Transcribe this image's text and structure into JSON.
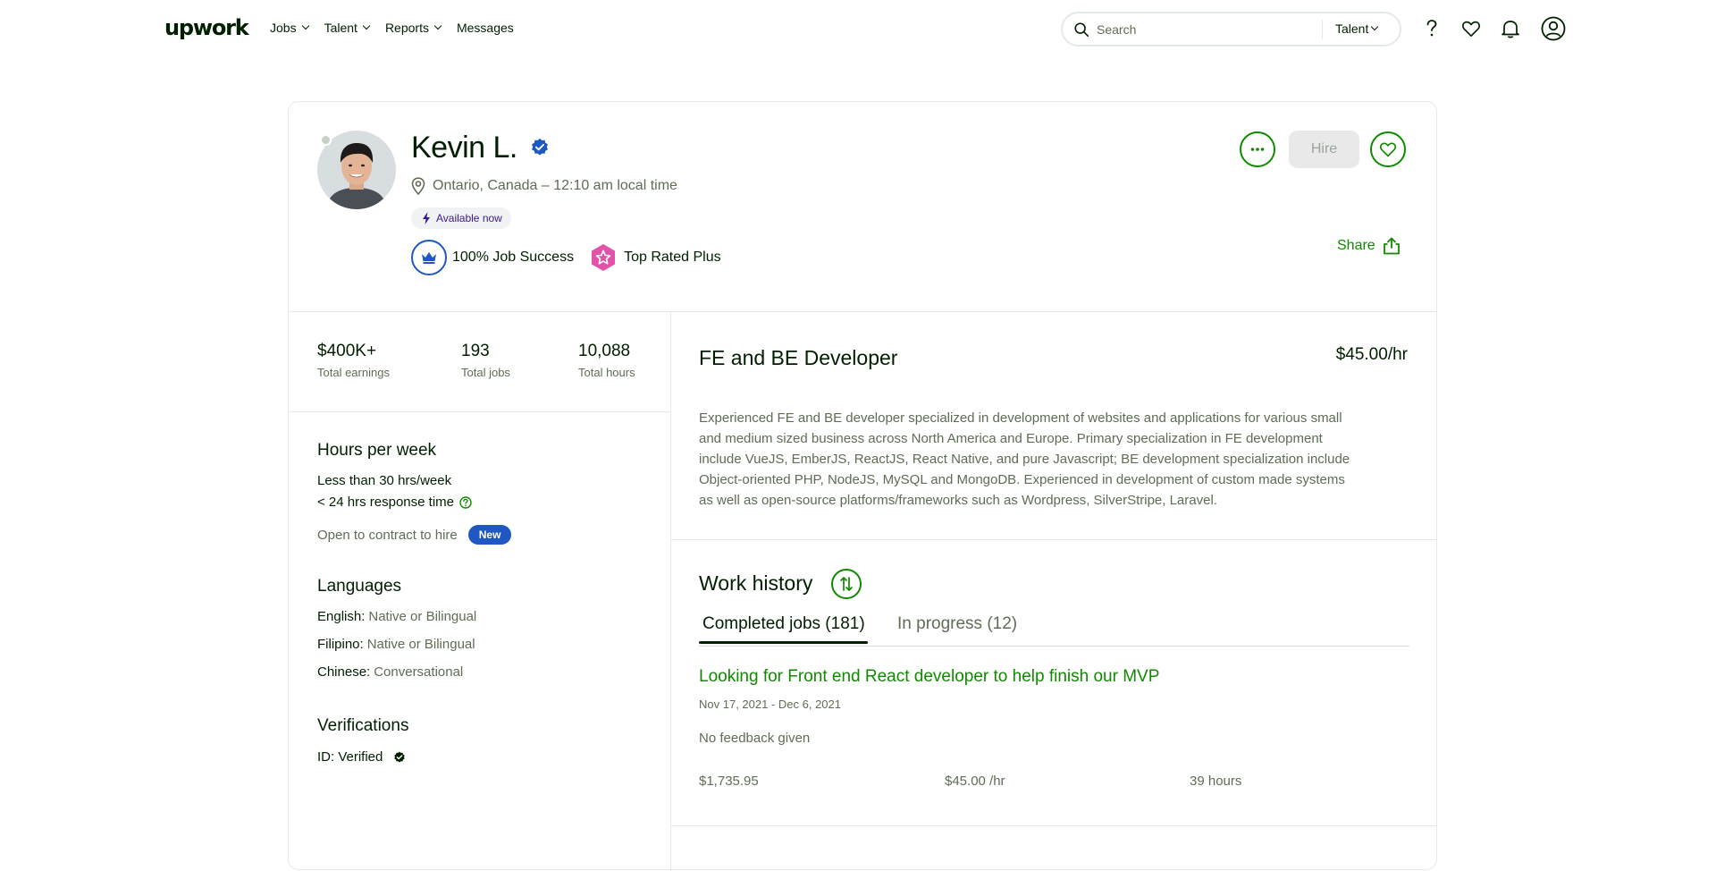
{
  "nav": {
    "logo": "upwork",
    "links": [
      "Jobs",
      "Talent",
      "Reports",
      "Messages"
    ],
    "search_placeholder": "Search",
    "search_scope": "Talent",
    "icons": [
      "help-icon",
      "heart-icon",
      "bell-icon",
      "user-icon"
    ]
  },
  "profile": {
    "name": "Kevin L.",
    "location": "Ontario, Canada – 12:10 am local time",
    "availability": "Available now",
    "job_success": "100% Job Success",
    "top_rated": "Top Rated Plus",
    "hire_label": "Hire",
    "share_label": "Share"
  },
  "stats": [
    {
      "value": "$400K+",
      "label": "Total earnings"
    },
    {
      "value": "193",
      "label": "Total jobs"
    },
    {
      "value": "10,088",
      "label": "Total hours"
    }
  ],
  "hours": {
    "title": "Hours per week",
    "availability": "Less than 30 hrs/week",
    "response": "< 24 hrs response time",
    "contract": "Open to contract to hire",
    "new_badge": "New"
  },
  "languages": {
    "title": "Languages",
    "items": [
      {
        "name": "English:",
        "level": "Native or Bilingual"
      },
      {
        "name": "Filipino:",
        "level": "Native or Bilingual"
      },
      {
        "name": "Chinese:",
        "level": "Conversational"
      }
    ]
  },
  "verifications": {
    "title": "Verifications",
    "id": "ID: Verified"
  },
  "headline": {
    "title": "FE and BE Developer",
    "rate": "$45.00/hr",
    "overview_lines": [
      "Experienced FE and BE developer specialized in development of websites and applications for various small",
      "and medium sized business across North America and Europe. Primary specialization in FE development",
      "include VueJS, EmberJS, ReactJS, React Native, and pure Javascript; BE development specialization include",
      "Object-oriented PHP, NodeJS, MySQL and MongoDB. Experienced in development of custom made systems",
      "as well as open-source platforms/frameworks such as Wordpress, SilverStripe, Laravel."
    ]
  },
  "work_history": {
    "title": "Work history",
    "tabs": [
      "Completed jobs (181)",
      "In progress (12)"
    ],
    "job": {
      "title": "Looking for Front end React developer to help finish our MVP",
      "dates": "Nov 17, 2021 - Dec 6, 2021",
      "feedback": "No feedback given",
      "earned": "$1,735.95",
      "rate": "$45.00 /hr",
      "hours": "39 hours"
    }
  },
  "colors": {
    "brand_green": "#108a00",
    "verified_blue": "#1f57c3",
    "top_rated_pink": "#e352a9",
    "availability_purple": "#3c1a8c"
  }
}
